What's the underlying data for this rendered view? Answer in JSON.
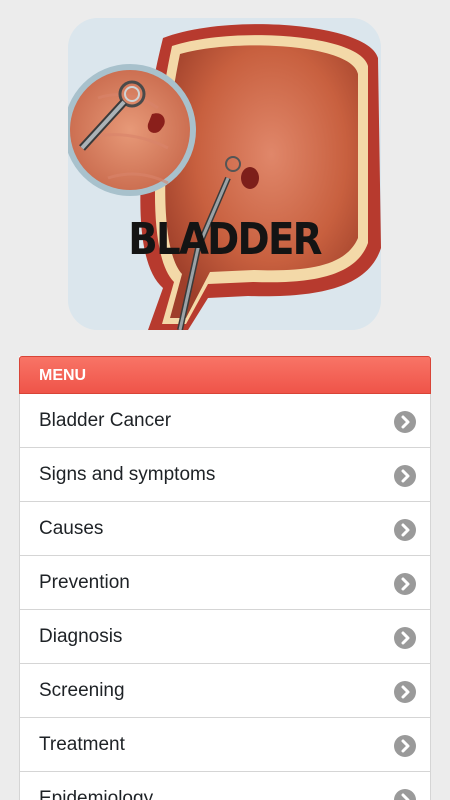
{
  "banner": {
    "title": "BLADDER"
  },
  "menu": {
    "header": "MENU",
    "items": [
      {
        "label": "Bladder Cancer",
        "icon": "chevron-right-icon"
      },
      {
        "label": "Signs and symptoms",
        "icon": "chevron-right-icon"
      },
      {
        "label": "Causes",
        "icon": "chevron-right-icon"
      },
      {
        "label": "Prevention",
        "icon": "chevron-right-icon"
      },
      {
        "label": "Diagnosis",
        "icon": "chevron-right-icon"
      },
      {
        "label": "Screening",
        "icon": "chevron-right-icon"
      },
      {
        "label": "Treatment",
        "icon": "chevron-right-icon"
      },
      {
        "label": "Epidemiology",
        "icon": "chevron-right-icon"
      }
    ]
  },
  "colors": {
    "background": "#ececec",
    "menu_header": "#ef5449",
    "chevron": "#9a9a9a",
    "text": "#1e2226"
  }
}
